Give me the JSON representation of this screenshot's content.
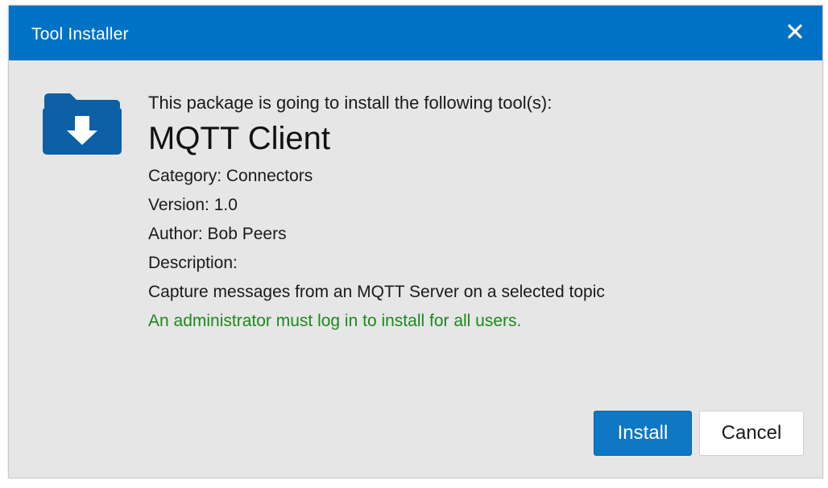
{
  "dialog": {
    "title": "Tool Installer",
    "close_icon": "close-icon",
    "folder_icon": "folder-download-icon",
    "intro": "This package is going to install the following tool(s):",
    "tool_name": "MQTT Client",
    "category": "Category: Connectors",
    "version": "Version: 1.0",
    "author": "Author: Bob Peers",
    "description_label": "Description:",
    "description": "Capture messages from an MQTT Server on a selected topic",
    "admin_note": "An administrator must log in to install for all users.",
    "install_label": "Install",
    "cancel_label": "Cancel"
  },
  "colors": {
    "titlebar": "#0072c6",
    "install_button": "#0e78c4",
    "admin_note": "#1a8a1a",
    "dialog_bg": "#e6e6e6"
  }
}
